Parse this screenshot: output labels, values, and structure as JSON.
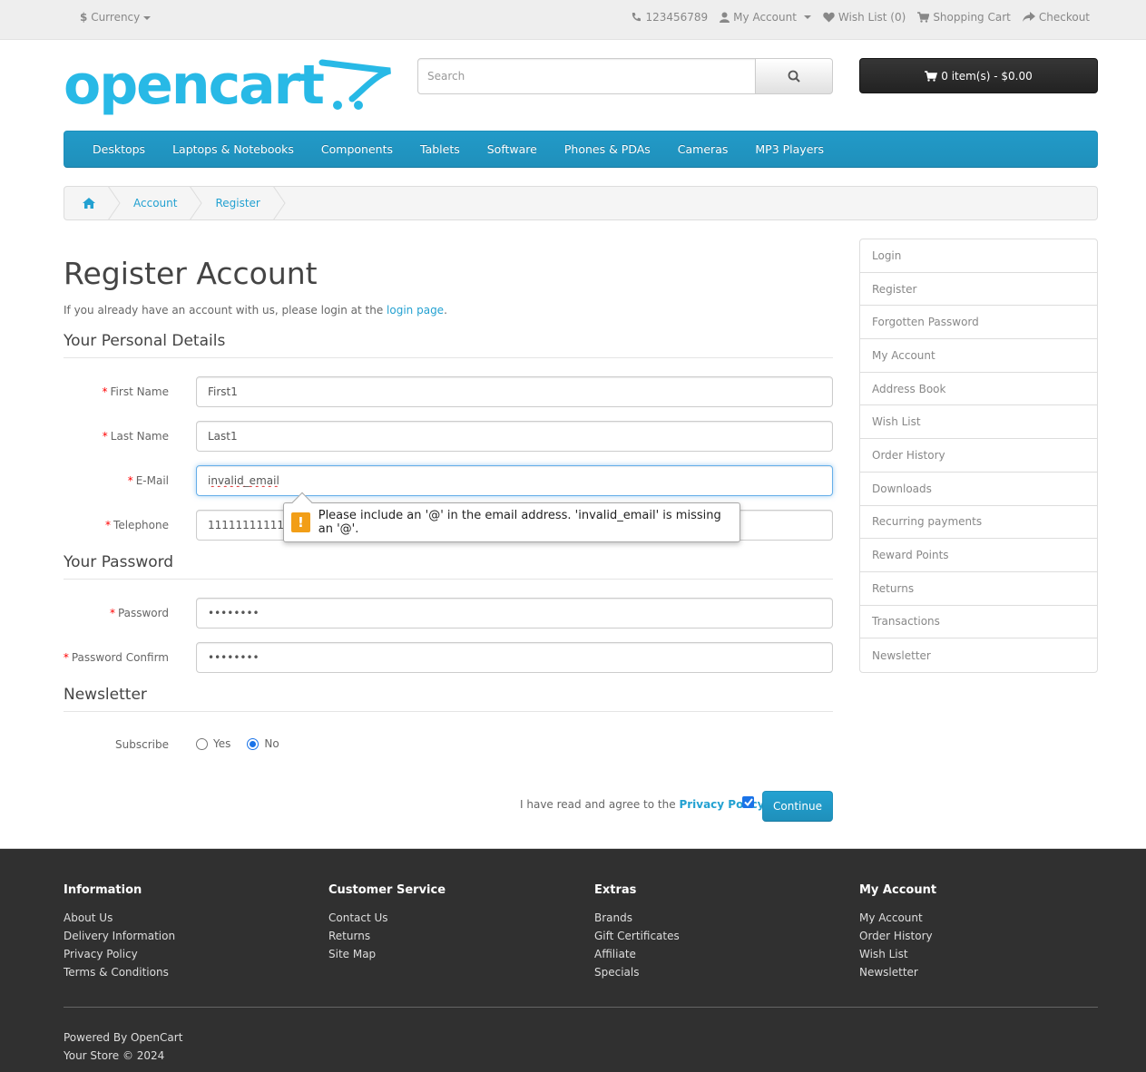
{
  "topbar": {
    "currency_label": "Currency",
    "phone": "123456789",
    "my_account": "My Account",
    "wish_list": "Wish List (0)",
    "shopping_cart": "Shopping Cart",
    "checkout": "Checkout"
  },
  "logo": {
    "text": "opencart"
  },
  "search": {
    "placeholder": "Search",
    "value": ""
  },
  "cart": {
    "label": "0 item(s) - $0.00"
  },
  "menu": {
    "items": [
      "Desktops",
      "Laptops & Notebooks",
      "Components",
      "Tablets",
      "Software",
      "Phones & PDAs",
      "Cameras",
      "MP3 Players"
    ]
  },
  "breadcrumb": {
    "items": [
      "Account",
      "Register"
    ]
  },
  "page": {
    "title": "Register Account",
    "intro_text": "If you already have an account with us, please login at the ",
    "intro_link": "login page",
    "intro_end": "."
  },
  "personal": {
    "legend": "Your Personal Details",
    "first_name_label": "First Name",
    "first_name_value": "First1",
    "last_name_label": "Last Name",
    "last_name_value": "Last1",
    "email_label": "E-Mail",
    "email_value": "invalid_email",
    "telephone_label": "Telephone",
    "telephone_value": "11111111111"
  },
  "validation": {
    "message": "Please include an '@' in the email address. 'invalid_email' is missing an '@'."
  },
  "password": {
    "legend": "Your Password",
    "password_label": "Password",
    "password_value": "••••••••",
    "confirm_label": "Password Confirm",
    "confirm_value": "••••••••"
  },
  "newsletter": {
    "legend": "Newsletter",
    "subscribe_label": "Subscribe",
    "yes_label": "Yes",
    "no_label": "No",
    "selected": "No"
  },
  "agree": {
    "text": "I have read and agree to the ",
    "policy_link": "Privacy Policy",
    "checked": true,
    "continue_label": "Continue"
  },
  "sidebar": {
    "items": [
      "Login",
      "Register",
      "Forgotten Password",
      "My Account",
      "Address Book",
      "Wish List",
      "Order History",
      "Downloads",
      "Recurring payments",
      "Reward Points",
      "Returns",
      "Transactions",
      "Newsletter"
    ]
  },
  "footer": {
    "columns": [
      {
        "title": "Information",
        "links": [
          "About Us",
          "Delivery Information",
          "Privacy Policy",
          "Terms & Conditions"
        ]
      },
      {
        "title": "Customer Service",
        "links": [
          "Contact Us",
          "Returns",
          "Site Map"
        ]
      },
      {
        "title": "Extras",
        "links": [
          "Brands",
          "Gift Certificates",
          "Affiliate",
          "Specials"
        ]
      },
      {
        "title": "My Account",
        "links": [
          "My Account",
          "Order History",
          "Wish List",
          "Newsletter"
        ]
      }
    ],
    "powered_prefix": "Powered By ",
    "powered_link": "OpenCart",
    "copyright": "Your Store © 2024"
  },
  "colors": {
    "accent": "#23a1d1",
    "menu": "#229ac8",
    "footer": "#303030",
    "logo": "#28b9e6",
    "warning": "#f29e17"
  }
}
